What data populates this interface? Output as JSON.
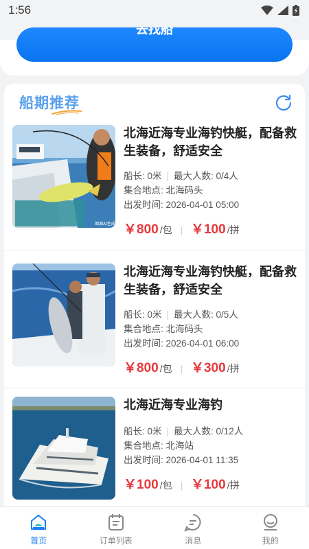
{
  "status_bar": {
    "time": "1:56"
  },
  "top": {
    "find_boat_label": "去找船"
  },
  "section": {
    "title": "船期推荐"
  },
  "listings": [
    {
      "title": "北海近海专业海钓快艇，配备救生装备，舒适安全",
      "captain": "船长: 0米",
      "max_people": "最大人数: 0/4人",
      "meet_point": "集合地点: 北海码头",
      "departure": "出发时间: 2026-04-01 05:00",
      "charter_price": "￥800",
      "charter_unit": "/包",
      "shared_price": "￥100",
      "shared_unit": "/拼",
      "image_caption": "图源AI生成"
    },
    {
      "title": "北海近海专业海钓快艇，配备救生装备，舒适安全",
      "captain": "船长: 0米",
      "max_people": "最大人数: 0/5人",
      "meet_point": "集合地点: 北海码头",
      "departure": "出发时间: 2026-04-01 06:00",
      "charter_price": "￥800",
      "charter_unit": "/包",
      "shared_price": "￥300",
      "shared_unit": "/拼"
    },
    {
      "title": "北海近海专业海钓",
      "captain": "船长: 0米",
      "max_people": "最大人数: 0/12人",
      "meet_point": "集合地点: 北海站",
      "departure": "出发时间: 2026-04-01 11:35",
      "charter_price": "￥100",
      "charter_unit": "/包",
      "shared_price": "￥100",
      "shared_unit": "/拼"
    }
  ],
  "tabs": [
    {
      "label": "首页",
      "icon": "home-icon",
      "active": true
    },
    {
      "label": "订单列表",
      "icon": "order-list-icon",
      "active": false
    },
    {
      "label": "消息",
      "icon": "message-icon",
      "active": false
    },
    {
      "label": "我的",
      "icon": "profile-icon",
      "active": false
    }
  ],
  "colors": {
    "accent": "#1a7ef5",
    "price": "#e8383d",
    "title_blue": "#5aa0ee"
  }
}
